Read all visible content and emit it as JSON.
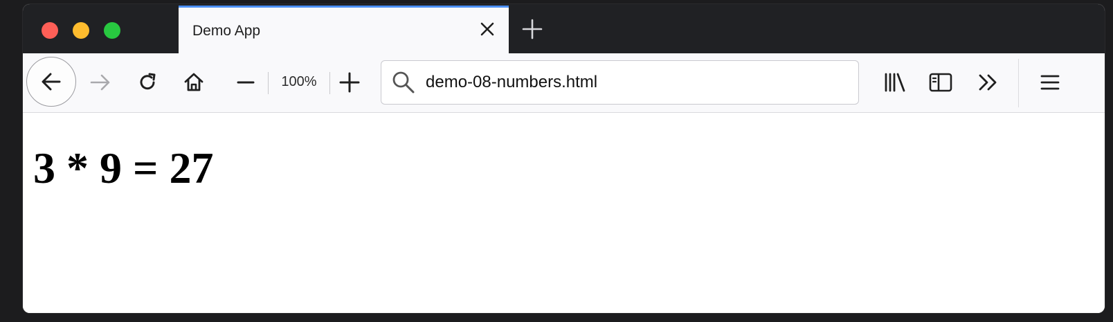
{
  "window": {
    "controls": {
      "close_color": "#fe5f57",
      "minimize_color": "#febc2e",
      "zoom_color": "#28c840"
    }
  },
  "tabs": [
    {
      "title": "Demo App",
      "active": true,
      "accent_color": "#4b8ff4"
    }
  ],
  "toolbar": {
    "zoom_level": "100%",
    "url": "demo-08-numbers.html",
    "icons": [
      "back-arrow-icon",
      "forward-arrow-icon",
      "reload-icon",
      "home-icon",
      "zoom-out-icon",
      "zoom-in-icon",
      "search-icon",
      "library-icon",
      "sidebar-icon",
      "overflow-chevron-icon",
      "hamburger-menu-icon"
    ]
  },
  "page": {
    "heading": "3 * 9 = 27"
  }
}
